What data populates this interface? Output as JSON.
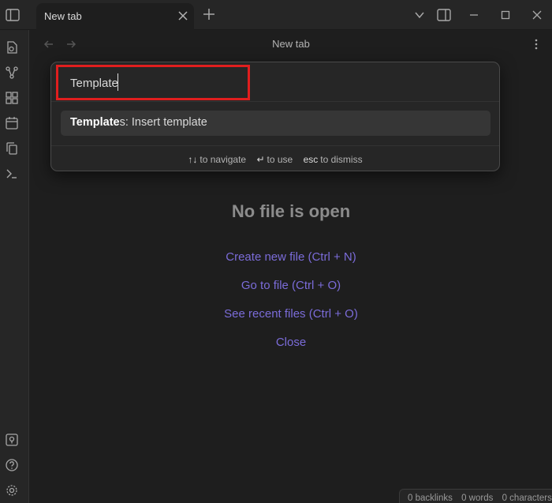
{
  "tab": {
    "title": "New tab"
  },
  "view": {
    "title": "New tab"
  },
  "palette": {
    "query": "Template",
    "suggestion": {
      "match": "Template",
      "rest": "s: Insert template"
    },
    "instructions": [
      {
        "key": "↑↓",
        "text": "to navigate"
      },
      {
        "key": "↵",
        "text": "to use"
      },
      {
        "key": "esc",
        "text": "to dismiss"
      }
    ]
  },
  "empty_state": {
    "title": "No file is open",
    "actions": [
      "Create new file (Ctrl + N)",
      "Go to file (Ctrl + O)",
      "See recent files (Ctrl + O)",
      "Close"
    ]
  },
  "status": {
    "backlinks": "0 backlinks",
    "words": "0 words",
    "characters": "0 characters"
  },
  "colors": {
    "accent": "#7b6cd9",
    "highlight": "#e01e1e",
    "background": "#1e1e1e"
  }
}
